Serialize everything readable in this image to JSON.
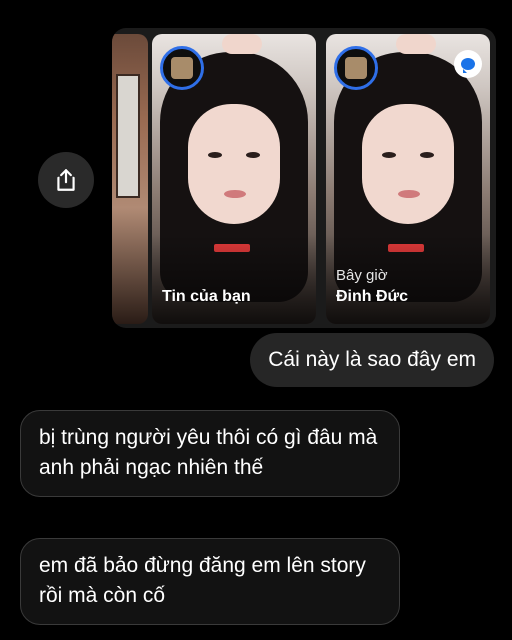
{
  "shared_story": {
    "tiles": [
      {
        "label": "Tin của bạn"
      },
      {
        "subtitle": "Bây giờ",
        "label": "Đinh Đức"
      }
    ]
  },
  "icons": {
    "share": "share-icon",
    "reply": "message-bubble-icon"
  },
  "messages": [
    {
      "direction": "outgoing",
      "text": "Cái này là sao đây em"
    },
    {
      "direction": "incoming",
      "text": "bị trùng người yêu thôi có gì đâu mà anh phải ngạc nhiên thế"
    },
    {
      "direction": "incoming",
      "text": "em đã bảo đừng đăng em lên story rồi mà còn cố"
    }
  ],
  "colors": {
    "background": "#000000",
    "outgoing_bubble": "#262626",
    "incoming_border": "#3a3a3a",
    "story_ring": "#2f6fe8"
  }
}
